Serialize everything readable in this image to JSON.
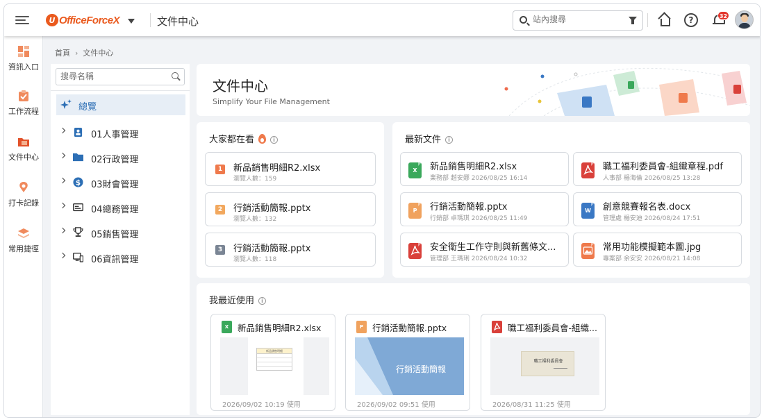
{
  "topbar": {
    "logo_text": "OfficeForceX",
    "page_title": "文件中心",
    "search_placeholder": "站內搜尋",
    "notification_count": "32",
    "help_label": "?"
  },
  "left_nav": [
    {
      "label": "資訊入口",
      "icon": "dashboard-icon"
    },
    {
      "label": "工作流程",
      "icon": "workflow-icon"
    },
    {
      "label": "文件中心",
      "icon": "document-folder-icon"
    },
    {
      "label": "打卡記錄",
      "icon": "location-pin-icon"
    },
    {
      "label": "常用捷徑",
      "icon": "stack-layers-icon"
    }
  ],
  "breadcrumb": {
    "home": "首頁",
    "current": "文件中心"
  },
  "tree": {
    "search_placeholder": "搜尋名稱",
    "overview": "總覽",
    "items": [
      {
        "label": "01人事管理",
        "icon": "person-badge-icon"
      },
      {
        "label": "02行政管理",
        "icon": "folder-icon"
      },
      {
        "label": "03財會管理",
        "icon": "dollar-coin-icon"
      },
      {
        "label": "04總務管理",
        "icon": "id-card-icon"
      },
      {
        "label": "05銷售管理",
        "icon": "trophy-icon"
      },
      {
        "label": "06資訊管理",
        "icon": "computer-icon"
      }
    ]
  },
  "banner": {
    "title": "文件中心",
    "subtitle": "Simplify Your File Management"
  },
  "popular": {
    "title": "大家都在看",
    "items": [
      {
        "rank": "1",
        "name": "新品銷售明細R2.xlsx",
        "meta": "瀏覽人數：159",
        "color": "#ef7a4c"
      },
      {
        "rank": "2",
        "name": "行銷活動簡報.pptx",
        "meta": "瀏覽人數：132",
        "color": "#f2a85e"
      },
      {
        "rank": "3",
        "name": "行銷活動簡報.pptx",
        "meta": "瀏覽人數：118",
        "color": "#7a8594"
      }
    ]
  },
  "latest": {
    "title": "最新文件",
    "items": [
      {
        "type": "X",
        "cls": "c-x",
        "name": "新品銷售明細R2.xlsx",
        "meta": "業務部 趙安娜 2026/08/25 16:14"
      },
      {
        "type": "PDF",
        "cls": "c-pdf",
        "name": "職工福利委員會-組織章程.pdf",
        "meta": "人事部 楊海倫 2026/08/25 13:28"
      },
      {
        "type": "P",
        "cls": "c-p",
        "name": "行銷活動簡報.pptx",
        "meta": "行銷部 卓瑪琪 2026/08/25 11:49"
      },
      {
        "type": "W",
        "cls": "c-w",
        "name": "創意競賽報名表.docx",
        "meta": "管理處 楊安迪 2026/08/24 17:51"
      },
      {
        "type": "PDF",
        "cls": "c-pdf",
        "name": "安全衛生工作守則與新舊條文...",
        "meta": "管理部 王瑪琍 2026/08/24 10:32"
      },
      {
        "type": "IMG",
        "cls": "c-img",
        "name": "常用功能模擬範本圖.jpg",
        "meta": "專案部 余安安 2026/08/21 14:08"
      }
    ]
  },
  "recent": {
    "title": "我最近使用",
    "items": [
      {
        "type": "X",
        "cls": "c-x",
        "name": "新品銷售明細R2.xlsx",
        "date": "2026/09/02 10:19 使用",
        "thumb_text": "新品銷售明細"
      },
      {
        "type": "P",
        "cls": "c-p",
        "name": "行銷活動簡報.pptx",
        "date": "2026/09/02 09:51 使用",
        "thumb_text": "行銷活動簡報"
      },
      {
        "type": "PDF",
        "cls": "c-pdf",
        "name": "職工福利委員會-組織...",
        "date": "2026/08/31 11:25 使用",
        "thumb_text": "職工福利委員會"
      }
    ]
  }
}
